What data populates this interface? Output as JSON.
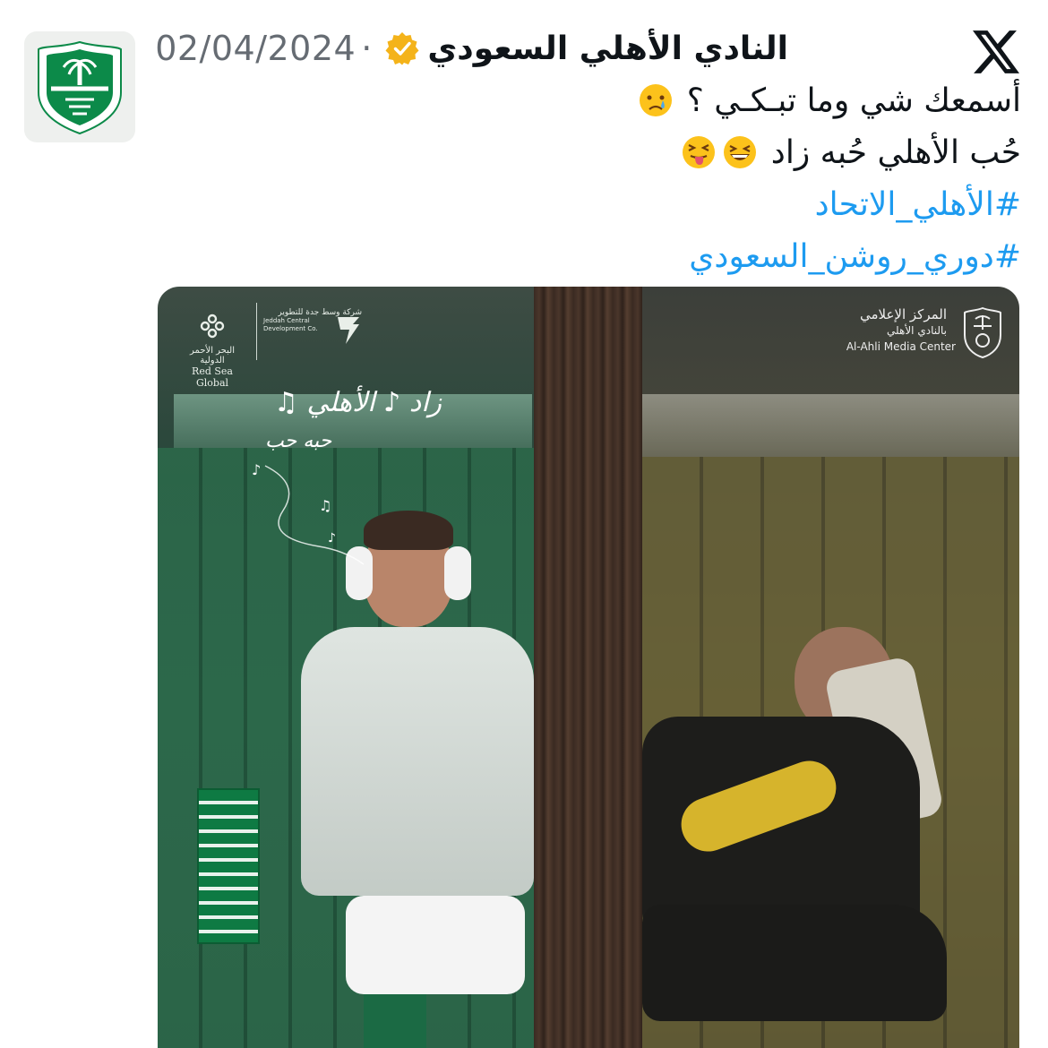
{
  "tweet": {
    "account_name": "النادي الأهلي السعودي",
    "separator": "·",
    "date": "02/04/2024",
    "lines": [
      "أسمعك شي وما تبـكـي ؟",
      "حُب الأهلي حُبه زاد"
    ],
    "hashtags": [
      "#الأهلي_الاتحاد",
      "#دوري_روشن_السعودي"
    ]
  },
  "icons": {
    "platform": "x-logo-icon",
    "verified": "verified-badge-icon",
    "emoji_line1": "crying-face-emoji",
    "emoji_line2": [
      "grinning-squinting-face-emoji",
      "squinting-face-with-tongue-emoji"
    ]
  },
  "media": {
    "sponsor_arabic": "البحر الأحمر الدولية",
    "sponsor_english": "Red Sea Global",
    "partner_arabic": "شركة وسط جدة للتطوير",
    "partner_english": "Jeddah Central Development Co.",
    "media_center_arabic_1": "المركز الإعلامي",
    "media_center_arabic_2": "بالنادي الأهلي",
    "media_center_english": "Al-Ahli Media Center",
    "lyric_1": "الأهلي",
    "lyric_2": "زاد",
    "lyric_3": "حب",
    "lyric_4": "حبه"
  },
  "colors": {
    "text": "#0f1419",
    "muted": "#666c73",
    "link": "#1d9bf0",
    "verified": "#f4b31a",
    "club_green": "#0c8a49"
  }
}
